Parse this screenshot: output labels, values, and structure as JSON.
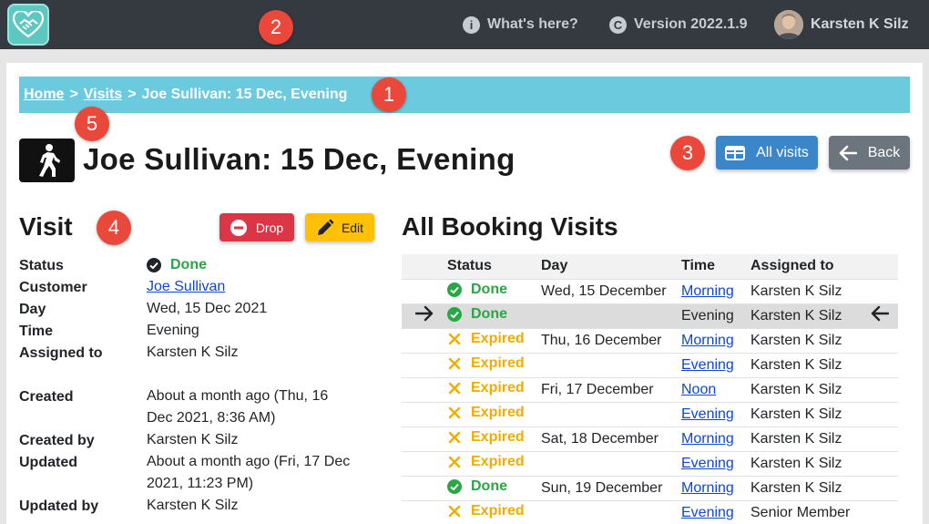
{
  "header": {
    "whats_here": "What's here?",
    "version": "Version 2022.1.9",
    "user_name": "Karsten K Silz",
    "info_glyph": "i",
    "copyright_glyph": "C"
  },
  "callouts": [
    "1",
    "2",
    "3",
    "4",
    "5"
  ],
  "breadcrumb": {
    "home": "Home",
    "visits": "Visits",
    "current": "Joe Sullivan: 15 Dec, Evening",
    "separator": ">"
  },
  "page": {
    "title": "Joe Sullivan: 15 Dec, Evening",
    "all_visits_label": "All visits",
    "back_label": "Back"
  },
  "visit": {
    "heading": "Visit",
    "drop_label": "Drop",
    "edit_label": "Edit",
    "fields": {
      "status_label": "Status",
      "status_value": "Done",
      "customer_label": "Customer",
      "customer_value": "Joe Sullivan",
      "day_label": "Day",
      "day_value": "Wed, 15 Dec 2021",
      "time_label": "Time",
      "time_value": "Evening",
      "assigned_label": "Assigned to",
      "assigned_value": "Karsten K Silz",
      "created_label": "Created",
      "created_value": "About a month ago (Thu, 16 Dec 2021, 8:36 AM)",
      "created_by_label": "Created by",
      "created_by_value": "Karsten K Silz",
      "updated_label": "Updated",
      "updated_value": "About a month ago (Fri, 17 Dec 2021, 11:23 PM)",
      "updated_by_label": "Updated by",
      "updated_by_value": "Karsten K Silz"
    }
  },
  "booking": {
    "heading": "All Booking Visits",
    "columns": [
      "Status",
      "Day",
      "Time",
      "Assigned to"
    ],
    "rows": [
      {
        "status": "Done",
        "day": "Wed, 15 December",
        "time": "Morning",
        "time_link": true,
        "assigned": "Karsten K Silz",
        "current": false
      },
      {
        "status": "Done",
        "day": "",
        "time": "Evening",
        "time_link": false,
        "assigned": "Karsten K Silz",
        "current": true
      },
      {
        "status": "Expired",
        "day": "Thu, 16 December",
        "time": "Morning",
        "time_link": true,
        "assigned": "Karsten K Silz",
        "current": false
      },
      {
        "status": "Expired",
        "day": "",
        "time": "Evening",
        "time_link": true,
        "assigned": "Karsten K Silz",
        "current": false
      },
      {
        "status": "Expired",
        "day": "Fri, 17 December",
        "time": "Noon",
        "time_link": true,
        "assigned": "Karsten K Silz",
        "current": false
      },
      {
        "status": "Expired",
        "day": "",
        "time": "Evening",
        "time_link": true,
        "assigned": "Karsten K Silz",
        "current": false
      },
      {
        "status": "Expired",
        "day": "Sat, 18 December",
        "time": "Morning",
        "time_link": true,
        "assigned": "Karsten K Silz",
        "current": false
      },
      {
        "status": "Expired",
        "day": "",
        "time": "Evening",
        "time_link": true,
        "assigned": "Karsten K Silz",
        "current": false
      },
      {
        "status": "Done",
        "day": "Sun, 19 December",
        "time": "Morning",
        "time_link": true,
        "assigned": "Karsten K Silz",
        "current": false
      },
      {
        "status": "Expired",
        "day": "",
        "time": "Evening",
        "time_link": true,
        "assigned": "Senior Member",
        "current": false
      }
    ]
  },
  "colors": {
    "topbar": "#343a40",
    "breadcrumb": "#6ccadf",
    "primary": "#3a86c8",
    "secondary": "#6c757d",
    "danger": "#dc3545",
    "warning": "#ffc107",
    "done": "#28a745",
    "expired": "#f0ad00",
    "callout": "#e9483b"
  }
}
